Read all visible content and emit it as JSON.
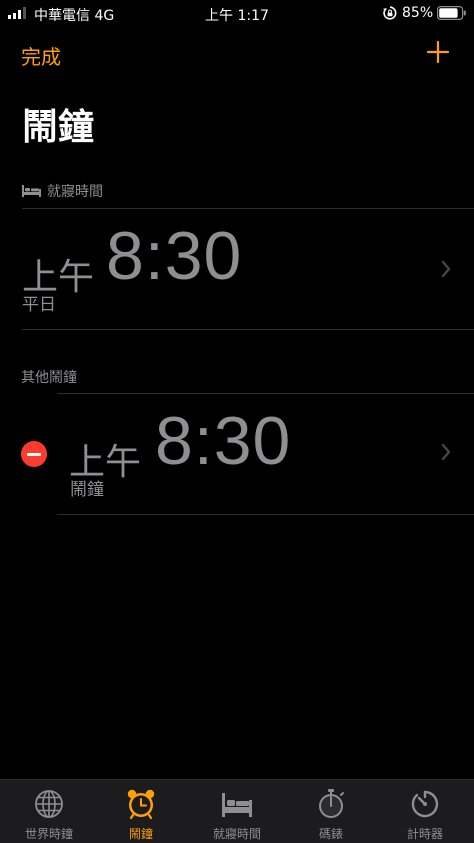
{
  "status_bar": {
    "carrier": "中華電信 4G",
    "time": "上午 1:17",
    "battery": "85%",
    "battery_level": 0.85
  },
  "nav": {
    "done_label": "完成",
    "add_icon": "plus-icon"
  },
  "page_title": "鬧鐘",
  "bedtime_section": {
    "header": "就寢時間",
    "icon": "bed-icon",
    "alarm": {
      "ampm": "上午",
      "time": "8:30",
      "label": "平日"
    }
  },
  "other_section": {
    "header": "其他鬧鐘",
    "alarms": [
      {
        "ampm": "上午",
        "time": "8:30",
        "label": "鬧鐘"
      }
    ]
  },
  "tab_bar": {
    "tabs": [
      {
        "label": "世界時鐘",
        "icon": "globe-icon"
      },
      {
        "label": "鬧鐘",
        "icon": "alarm-clock-icon",
        "active": true
      },
      {
        "label": "就寢時間",
        "icon": "bed-icon"
      },
      {
        "label": "碼錶",
        "icon": "stopwatch-icon"
      },
      {
        "label": "計時器",
        "icon": "timer-icon"
      }
    ]
  },
  "colors": {
    "accent": "#ff9f0a",
    "delete": "#ff3b30",
    "secondary_text": "#8e8e93",
    "background": "#000000",
    "tab_bar": "#1c1c1e"
  }
}
